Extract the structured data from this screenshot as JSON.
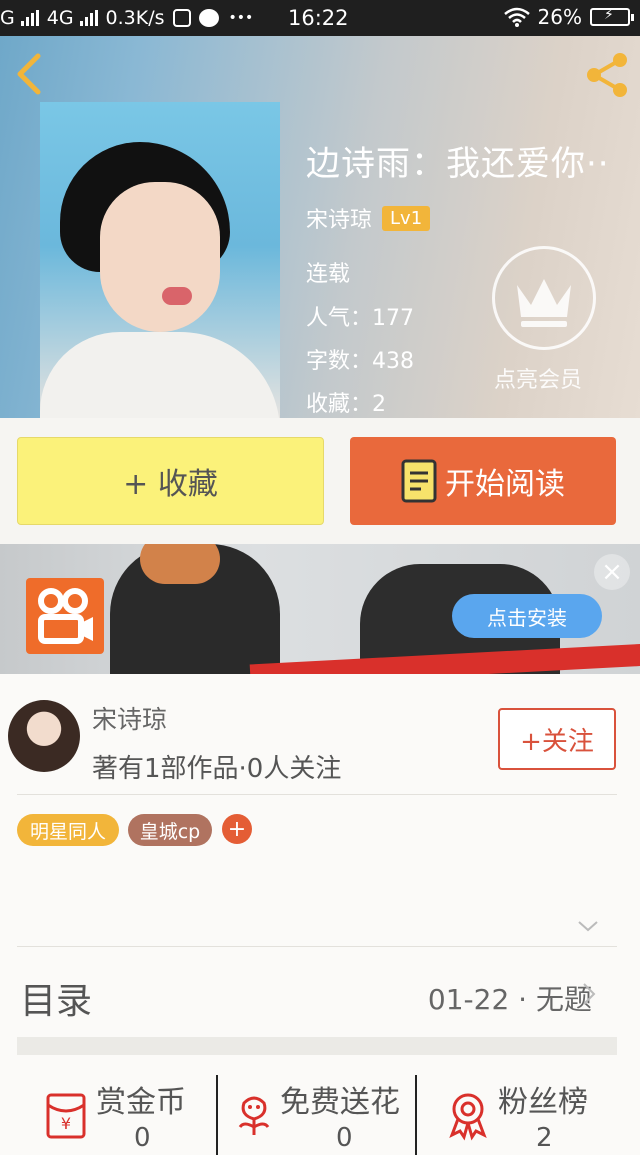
{
  "status_bar": {
    "carrier": "G",
    "network": "4G",
    "speed": "0.3K/s",
    "time": "16:22",
    "battery": "26%",
    "more": "•••"
  },
  "book": {
    "title": "边诗雨：我还爱你··",
    "author": "宋诗琼",
    "level": "Lv1",
    "status": "连载",
    "popularity": "人气：177",
    "word_count": "字数：438",
    "favorites": "收藏：2",
    "vip_label": "点亮会员"
  },
  "actions": {
    "collect_label": "+ 收藏",
    "read_label": "开始阅读"
  },
  "ad": {
    "install_label": "点击安装",
    "close_label": "×"
  },
  "author_info": {
    "name": "宋诗琼",
    "stats": "著有1部作品·0人关注",
    "follow_label": "+关注",
    "tags": [
      {
        "label": "明星同人",
        "color": "#f2b53a"
      },
      {
        "label": "皇城cp",
        "color": "#b07360"
      }
    ],
    "add_tag": "+"
  },
  "toc": {
    "label": "目录",
    "latest": "01-22 · 无题"
  },
  "bottom_bar": [
    {
      "label": "赏金币",
      "value": "0",
      "icon": "red-envelope-icon"
    },
    {
      "label": "免费送花",
      "value": "0",
      "icon": "flower-icon"
    },
    {
      "label": "粉丝榜",
      "value": "2",
      "icon": "award-ribbon-icon"
    }
  ],
  "colors": {
    "accent_orange": "#e9693c",
    "collect_yellow": "#fbf27a",
    "follow_red": "#d9523c",
    "install_blue": "#5aa6ee"
  }
}
